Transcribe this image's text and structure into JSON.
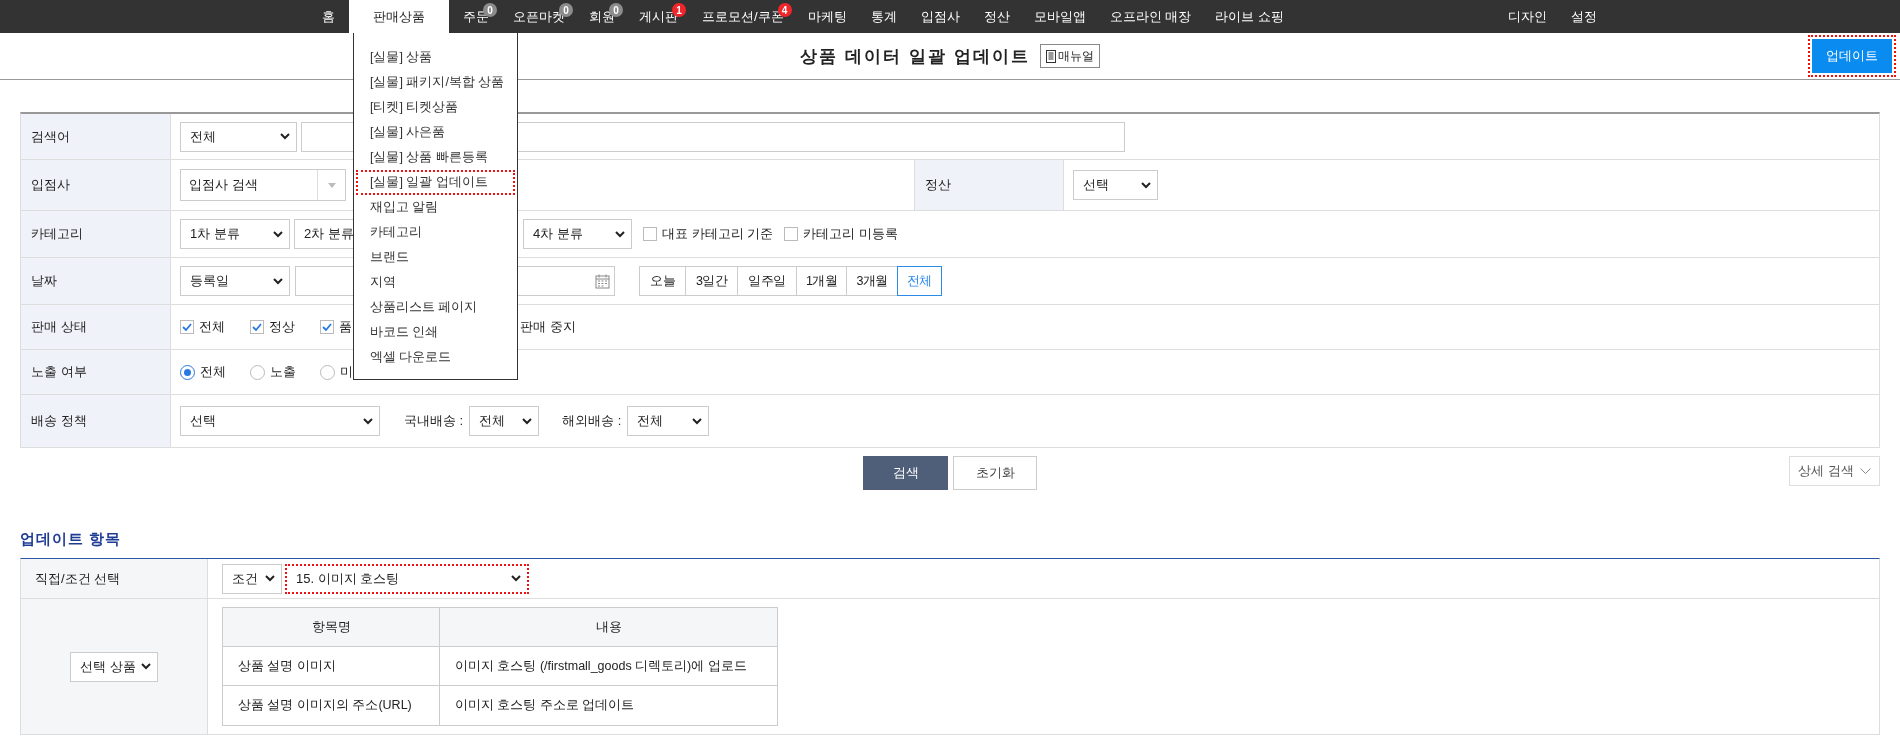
{
  "nav": {
    "items": [
      {
        "label": "홈",
        "selected": false
      },
      {
        "label": "판매상품",
        "selected": true
      },
      {
        "label": "주문",
        "selected": false,
        "badge": {
          "text": "0",
          "color": "#8c8c8c"
        }
      },
      {
        "label": "오픈마켓",
        "selected": false,
        "badge": {
          "text": "0",
          "color": "#8c8c8c"
        }
      },
      {
        "label": "회원",
        "selected": false,
        "badge": {
          "text": "0",
          "color": "#8c8c8c"
        }
      },
      {
        "label": "게시판",
        "selected": false,
        "badge": {
          "text": "1",
          "color": "#f0262b"
        }
      },
      {
        "label": "프로모션/쿠폰",
        "selected": false,
        "badge": {
          "text": "4",
          "color": "#f0262b"
        }
      },
      {
        "label": "마케팅",
        "selected": false
      },
      {
        "label": "통계",
        "selected": false
      },
      {
        "label": "입점사",
        "selected": false
      },
      {
        "label": "정산",
        "selected": false
      },
      {
        "label": "모바일앱",
        "selected": false
      },
      {
        "label": "오프라인 매장",
        "selected": false
      },
      {
        "label": "라이브 쇼핑",
        "selected": false
      }
    ],
    "right_items": [
      {
        "label": "디자인"
      },
      {
        "label": "설정"
      }
    ]
  },
  "dropdown_menu": {
    "items": [
      {
        "label": "[실물] 상품",
        "selected": false
      },
      {
        "label": "[실물] 패키지/복합 상품",
        "selected": false
      },
      {
        "label": "[티켓] 티켓상품",
        "selected": false
      },
      {
        "label": "[실물] 사은품",
        "selected": false
      },
      {
        "label": "[실물] 상품 빠른등록",
        "selected": false
      },
      {
        "label": "[실물] 일괄 업데이트",
        "selected": true
      },
      {
        "label": "재입고 알림",
        "selected": false
      },
      {
        "label": "카테고리",
        "selected": false
      },
      {
        "label": "브랜드",
        "selected": false
      },
      {
        "label": "지역",
        "selected": false
      },
      {
        "label": "상품리스트 페이지",
        "selected": false
      },
      {
        "label": "바코드 인쇄",
        "selected": false
      },
      {
        "label": "엑셀 다운로드",
        "selected": false
      }
    ]
  },
  "header": {
    "title": "상품 데이터 일괄 업데이트",
    "manual_button": "매뉴얼",
    "update_button": {
      "label": "업데이트",
      "highlighted": true
    }
  },
  "search_form": {
    "rows": [
      {
        "label": "검색어",
        "controls": [
          {
            "kind": "select",
            "value": "전체"
          },
          {
            "kind": "input"
          }
        ]
      },
      {
        "label": "입점사",
        "controls": [
          {
            "kind": "combo",
            "value": "입점사 검색"
          }
        ],
        "side": {
          "label": "정산",
          "controls": [
            {
              "kind": "select",
              "value": "선택"
            }
          ]
        }
      },
      {
        "label": "카테고리",
        "controls": [
          {
            "kind": "select",
            "value": "1차 분류"
          },
          {
            "kind": "select",
            "value": "2차 분류"
          },
          {
            "kind": "select",
            "value": "4차 분류"
          },
          {
            "kind": "checkbox",
            "label": "대표 카테고리 기준",
            "checked": false
          },
          {
            "kind": "checkbox",
            "label": "카테고리 미등록",
            "checked": false
          }
        ]
      },
      {
        "label": "날짜",
        "controls": [
          {
            "kind": "select",
            "value": "등록일"
          },
          {
            "kind": "date"
          },
          {
            "kind": "periods",
            "options": [
              {
                "label": "오늘",
                "selected": false
              },
              {
                "label": "3일간",
                "selected": false
              },
              {
                "label": "일주일",
                "selected": false
              },
              {
                "label": "1개월",
                "selected": false
              },
              {
                "label": "3개월",
                "selected": false
              },
              {
                "label": "전체",
                "selected": true
              }
            ]
          }
        ]
      },
      {
        "label": "판매 상태",
        "controls": [
          {
            "kind": "checkbox",
            "label": "전체",
            "checked": true
          },
          {
            "kind": "checkbox",
            "label": "정상",
            "checked": true
          },
          {
            "kind": "checkbox",
            "label": "품",
            "checked": true
          },
          {
            "kind": "text",
            "label": "판매 중지"
          }
        ]
      },
      {
        "label": "노출 여부",
        "controls": [
          {
            "kind": "radio",
            "label": "전체",
            "selected": true
          },
          {
            "kind": "radio",
            "label": "노출",
            "selected": false
          },
          {
            "kind": "radio",
            "label": "미",
            "selected": false
          }
        ]
      },
      {
        "label": "배송 정책",
        "controls": [
          {
            "kind": "select",
            "value": "선택"
          },
          {
            "kind": "text",
            "label": "국내배송 :"
          },
          {
            "kind": "select",
            "value": "전체"
          },
          {
            "kind": "text",
            "label": "해외배송 :"
          },
          {
            "kind": "select",
            "value": "전체"
          }
        ]
      }
    ],
    "search_button": "검색",
    "reset_button": "초기화",
    "detail_search_button": "상세 검색"
  },
  "update_section": {
    "title": "업데이트 항목",
    "mode_row": {
      "label": "직접/조건 선택",
      "mode_select": {
        "value": "조건"
      },
      "item_select": {
        "value": "15. 이미지 호스팅",
        "highlighted": true
      }
    },
    "target_select": {
      "value": "선택 상품"
    },
    "table": {
      "columns": [
        "항목명",
        "내용"
      ],
      "rows": [
        [
          "상품 설명 이미지",
          "이미지 호스팅 (/firstmall_goods 디렉토리)에 업로드"
        ],
        [
          "상품 설명 이미지의 주소(URL)",
          "이미지 호스팅 주소로 업데이트"
        ]
      ]
    }
  }
}
